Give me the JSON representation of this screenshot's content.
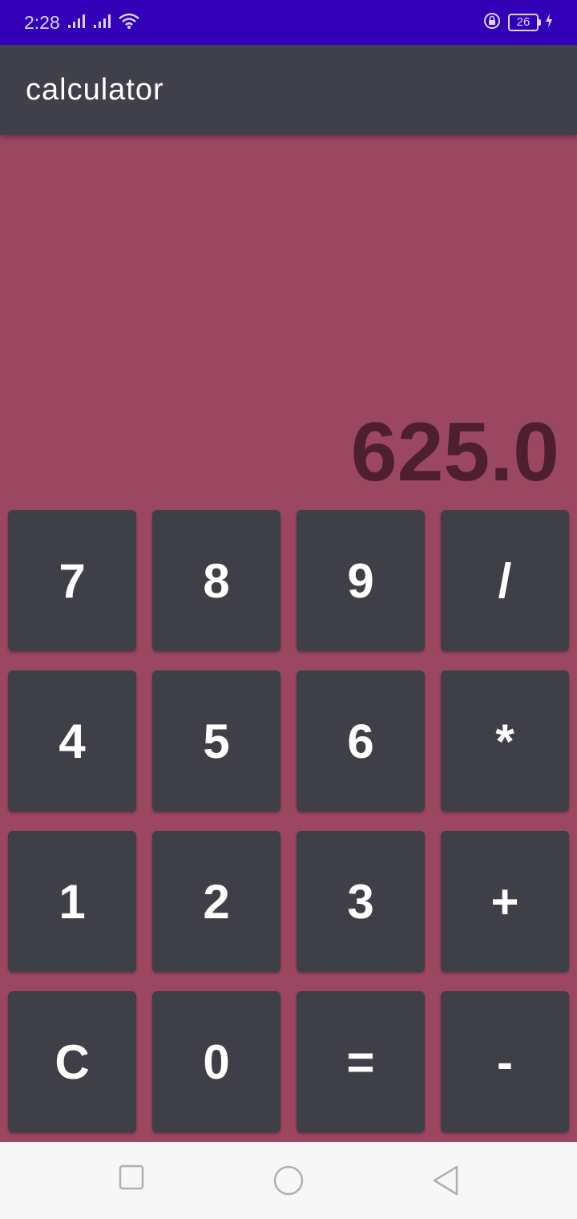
{
  "status_bar": {
    "time": "2:28",
    "battery": "26",
    "icons": [
      "signal-icon",
      "signal-icon",
      "wifi-icon",
      "rotation-lock-icon",
      "battery-icon",
      "charging-icon"
    ]
  },
  "app_bar": {
    "title": "calculator"
  },
  "display": {
    "value": "625.0"
  },
  "keypad": {
    "rows": [
      [
        "7",
        "8",
        "9",
        "/"
      ],
      [
        "4",
        "5",
        "6",
        "*"
      ],
      [
        "1",
        "2",
        "3",
        "+"
      ],
      [
        "C",
        "0",
        "=",
        "-"
      ]
    ]
  },
  "nav_bar": {
    "icons": [
      "recents-icon",
      "home-icon",
      "back-icon"
    ]
  },
  "colors": {
    "status_bar": "#3300b8",
    "app_bar": "#3f4049",
    "background": "#9c4762",
    "display_text": "#4e1f30",
    "key": "#3e3f47"
  }
}
